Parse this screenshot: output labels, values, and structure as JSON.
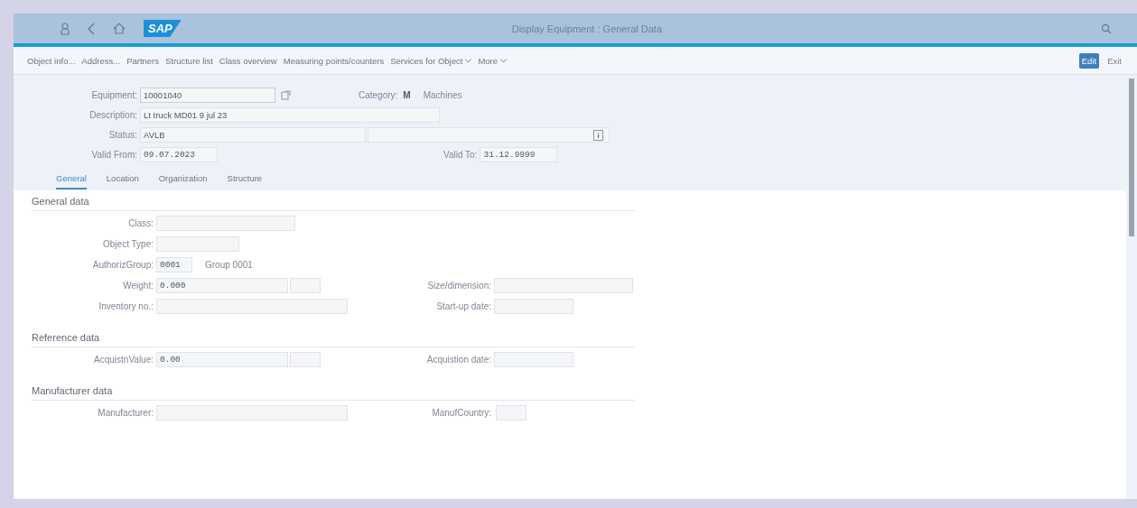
{
  "header": {
    "title": "Display Equipment : General Data",
    "logo": "SAP"
  },
  "toolbar": {
    "items": [
      {
        "label": "Object info...",
        "dropdown": false
      },
      {
        "label": "Address...",
        "dropdown": false
      },
      {
        "label": "Partners",
        "dropdown": false
      },
      {
        "label": "Structure list",
        "dropdown": false
      },
      {
        "label": "Class overview",
        "dropdown": false
      },
      {
        "label": "Measuring points/counters",
        "dropdown": false
      },
      {
        "label": "Services for Object",
        "dropdown": true
      },
      {
        "label": "More",
        "dropdown": true
      }
    ],
    "buttons": [
      {
        "label": "Edit",
        "kind": "primary"
      },
      {
        "label": "Exit",
        "kind": "plain"
      }
    ]
  },
  "header_form": {
    "equipment": {
      "label": "Equipment:",
      "value": "10001040"
    },
    "category": {
      "label": "Category:",
      "code": "M",
      "text": "Machines"
    },
    "description": {
      "label": "Description:",
      "value": "Lt truck MD01 9 jul 23"
    },
    "status": {
      "label": "Status:",
      "value": "AVLB"
    },
    "valid_from": {
      "label": "Valid From:",
      "value": "09.07.2023"
    },
    "valid_to": {
      "label": "Valid To:",
      "value": "31.12.9999"
    }
  },
  "tabs": [
    {
      "label": "General",
      "selected": true
    },
    {
      "label": "Location",
      "selected": false
    },
    {
      "label": "Organization",
      "selected": false
    },
    {
      "label": "Structure",
      "selected": false
    }
  ],
  "sections": [
    {
      "title": "General data",
      "rows": [
        {
          "left": {
            "label": "Class:",
            "fields": [
              {
                "kind": "name"
              }
            ]
          }
        },
        {
          "left": {
            "label": "Object Type:",
            "fields": [
              {
                "kind": "code"
              }
            ]
          }
        },
        {
          "left": {
            "label": "AuthorizGroup:",
            "fields": [
              {
                "kind": "short",
                "value": "0001"
              },
              {
                "kind": "text",
                "value": "Group 0001"
              }
            ]
          }
        },
        {
          "left": {
            "label": "Weight:",
            "fields": [
              {
                "kind": "quantity",
                "value": "0.000"
              },
              {
                "kind": "unit"
              }
            ]
          },
          "right": {
            "label": "Size/dimension:",
            "fields": [
              {
                "kind": "name"
              }
            ]
          }
        },
        {
          "left": {
            "label": "Inventory no.:",
            "fields": [
              {
                "kind": "long"
              }
            ]
          },
          "right": {
            "label": "Start-up date:",
            "fields": [
              {
                "kind": "date"
              }
            ]
          }
        }
      ]
    },
    {
      "title": "Reference data",
      "rows": [
        {
          "left": {
            "label": "AcquistnValue:",
            "fields": [
              {
                "kind": "quantity",
                "value": "0.00"
              },
              {
                "kind": "unit"
              }
            ]
          },
          "right": {
            "label": "Acquistion date:",
            "fields": [
              {
                "kind": "date"
              }
            ]
          }
        }
      ]
    },
    {
      "title": "Manufacturer data",
      "rows": [
        {
          "left": {
            "label": "Manufacturer:",
            "fields": [
              {
                "kind": "long"
              }
            ]
          },
          "right": {
            "label": "ManufCountry:",
            "fields": [
              {
                "kind": "unit"
              }
            ]
          }
        }
      ]
    }
  ]
}
